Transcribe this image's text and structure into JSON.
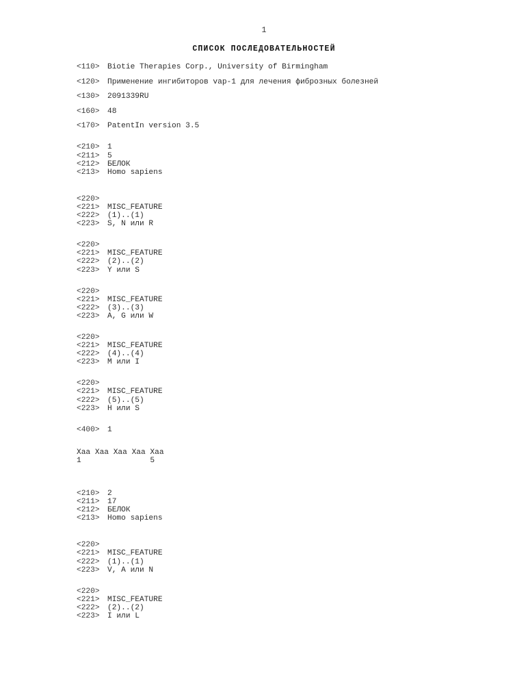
{
  "document": {
    "page_number": "1",
    "title": "СПИСОК ПОСЛЕДОВАТЕЛЬНОСТЕЙ"
  },
  "header_fields": [
    {
      "tag": "<110>",
      "value": "Biotie Therapies Corp., University of Birmingham"
    },
    {
      "tag": "<120>",
      "value": "Применение ингибиторов vap-1 для лечения фиброзных болезней"
    },
    {
      "tag": "<130>",
      "value": "2091339RU"
    },
    {
      "tag": "<160>",
      "value": "48"
    },
    {
      "tag": "<170>",
      "value": "PatentIn version 3.5"
    }
  ],
  "sequence_1": {
    "info": [
      {
        "tag": "<210>",
        "value": "1"
      },
      {
        "tag": "<211>",
        "value": "5"
      },
      {
        "tag": "<212>",
        "value": "БЕЛОК"
      },
      {
        "tag": "<213>",
        "value": "Homo sapiens"
      }
    ],
    "features": [
      {
        "open": "<220>",
        "lines": [
          {
            "tag": "<221>",
            "value": "MISC_FEATURE"
          },
          {
            "tag": "<222>",
            "value": "(1)..(1)"
          },
          {
            "tag": "<223>",
            "value": "S, N или R"
          }
        ]
      },
      {
        "open": "<220>",
        "lines": [
          {
            "tag": "<221>",
            "value": "MISC_FEATURE"
          },
          {
            "tag": "<222>",
            "value": "(2)..(2)"
          },
          {
            "tag": "<223>",
            "value": "Y или S"
          }
        ]
      },
      {
        "open": "<220>",
        "lines": [
          {
            "tag": "<221>",
            "value": "MISC_FEATURE"
          },
          {
            "tag": "<222>",
            "value": "(3)..(3)"
          },
          {
            "tag": "<223>",
            "value": "A, G или W"
          }
        ]
      },
      {
        "open": "<220>",
        "lines": [
          {
            "tag": "<221>",
            "value": "MISC_FEATURE"
          },
          {
            "tag": "<222>",
            "value": "(4)..(4)"
          },
          {
            "tag": "<223>",
            "value": "M или I"
          }
        ]
      },
      {
        "open": "<220>",
        "lines": [
          {
            "tag": "<221>",
            "value": "MISC_FEATURE"
          },
          {
            "tag": "<222>",
            "value": "(5)..(5)"
          },
          {
            "tag": "<223>",
            "value": "H или S"
          }
        ]
      }
    ],
    "sequence_marker": {
      "tag": "<400>",
      "value": "1"
    },
    "residues": "Xaa Xaa Xaa Xaa Xaa",
    "numbering": "1               5"
  },
  "sequence_2": {
    "info": [
      {
        "tag": "<210>",
        "value": "2"
      },
      {
        "tag": "<211>",
        "value": "17"
      },
      {
        "tag": "<212>",
        "value": "БЕЛОК"
      },
      {
        "tag": "<213>",
        "value": "Homo sapiens"
      }
    ],
    "features": [
      {
        "open": "<220>",
        "lines": [
          {
            "tag": "<221>",
            "value": "MISC_FEATURE"
          },
          {
            "tag": "<222>",
            "value": "(1)..(1)"
          },
          {
            "tag": "<223>",
            "value": "V, A или N"
          }
        ]
      },
      {
        "open": "<220>",
        "lines": [
          {
            "tag": "<221>",
            "value": "MISC_FEATURE"
          },
          {
            "tag": "<222>",
            "value": "(2)..(2)"
          },
          {
            "tag": "<223>",
            "value": "I или L"
          }
        ]
      }
    ]
  }
}
